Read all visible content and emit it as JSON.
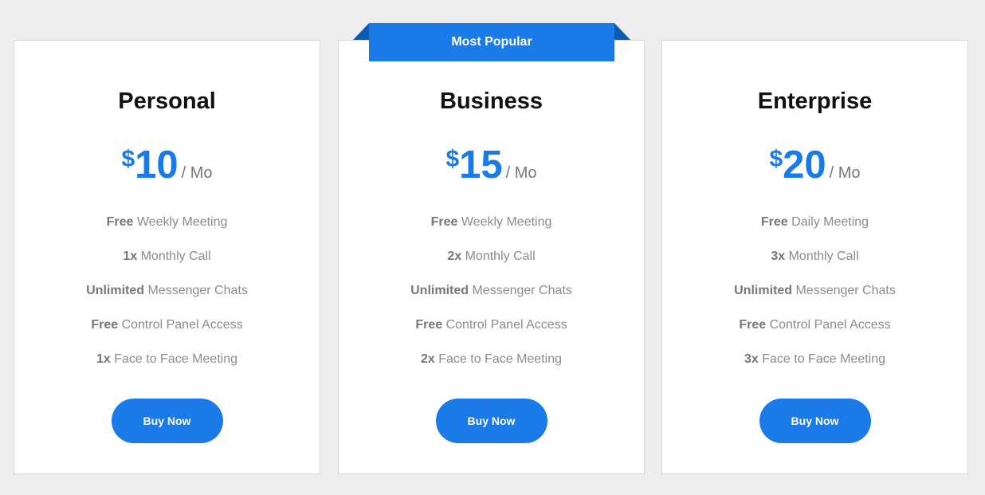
{
  "ribbon": {
    "label": "Most Popular"
  },
  "colors": {
    "accent": "#1a7ae8",
    "ribbon_fold": "#0d5bb5",
    "background": "#eeeeee"
  },
  "plans": [
    {
      "name": "Personal",
      "currency": "$",
      "price": "10",
      "period": "/ Mo",
      "features": [
        {
          "strong": "Free",
          "text": " Weekly Meeting"
        },
        {
          "strong": "1x",
          "text": " Monthly Call"
        },
        {
          "strong": "Unlimited",
          "text": " Messenger Chats"
        },
        {
          "strong": "Free",
          "text": " Control Panel Access"
        },
        {
          "strong": "1x",
          "text": " Face to Face Meeting"
        }
      ],
      "button": "Buy Now"
    },
    {
      "name": "Business",
      "currency": "$",
      "price": "15",
      "period": "/ Mo",
      "features": [
        {
          "strong": "Free",
          "text": " Weekly Meeting"
        },
        {
          "strong": "2x",
          "text": " Monthly Call"
        },
        {
          "strong": "Unlimited",
          "text": " Messenger Chats"
        },
        {
          "strong": "Free",
          "text": " Control Panel Access"
        },
        {
          "strong": "2x",
          "text": " Face to Face Meeting"
        }
      ],
      "button": "Buy Now"
    },
    {
      "name": "Enterprise",
      "currency": "$",
      "price": "20",
      "period": "/ Mo",
      "features": [
        {
          "strong": "Free",
          "text": " Daily Meeting"
        },
        {
          "strong": "3x",
          "text": " Monthly Call"
        },
        {
          "strong": "Unlimited",
          "text": " Messenger Chats"
        },
        {
          "strong": "Free",
          "text": " Control Panel Access"
        },
        {
          "strong": "3x",
          "text": " Face to Face Meeting"
        }
      ],
      "button": "Buy Now"
    }
  ]
}
